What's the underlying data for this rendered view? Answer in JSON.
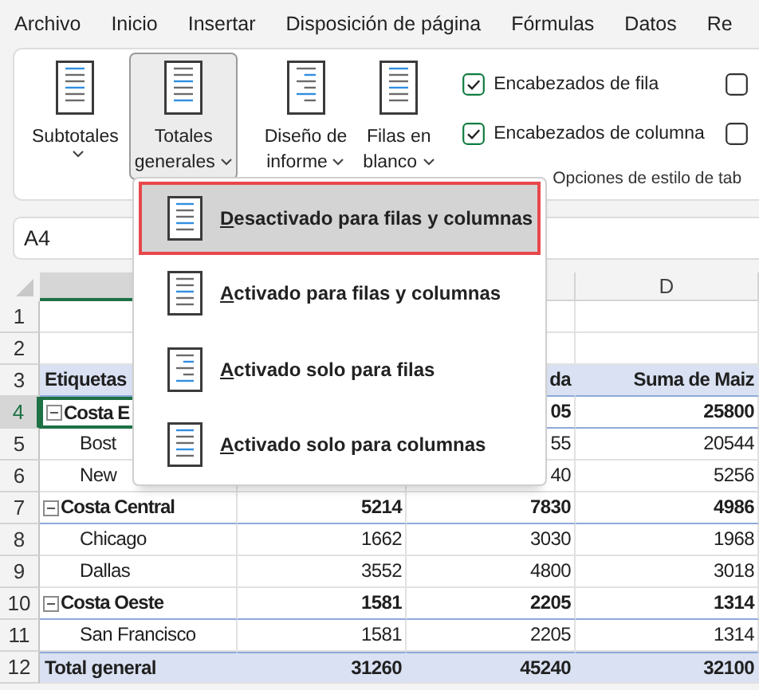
{
  "menu": [
    "Archivo",
    "Inicio",
    "Insertar",
    "Disposición de página",
    "Fórmulas",
    "Datos",
    "Re"
  ],
  "ribbon": {
    "buttons": [
      {
        "lines": [
          "Subtotales"
        ],
        "pressed": false
      },
      {
        "lines": [
          "Totales",
          "generales"
        ],
        "pressed": true
      },
      {
        "lines": [
          "Diseño de",
          "informe"
        ],
        "pressed": false
      },
      {
        "lines": [
          "Filas en",
          "blanco"
        ],
        "pressed": false
      }
    ],
    "checkboxes": [
      {
        "label": "Encabezados de fila",
        "checked": true
      },
      {
        "checked": false
      },
      {
        "label": "Encabezados de columna",
        "checked": true
      },
      {
        "checked": false
      }
    ],
    "group_label": "Opciones de estilo de tab"
  },
  "name_box": "A4",
  "column_header": "D",
  "rows": [
    {
      "number": "1",
      "kind": "blank",
      "selected": false
    },
    {
      "number": "2",
      "kind": "blank",
      "selected": false
    },
    {
      "number": "3",
      "kind": "header",
      "selected": false,
      "label": "Etiquetas",
      "column_c": "da",
      "column_d": "Suma de Maiz"
    },
    {
      "number": "4",
      "kind": "group",
      "selected": true,
      "label": "Costa E",
      "column_c": "05",
      "column_d": "25800"
    },
    {
      "number": "5",
      "kind": "item",
      "selected": false,
      "label": "Bost",
      "column_c": "55",
      "column_d": "20544"
    },
    {
      "number": "6",
      "kind": "item",
      "selected": false,
      "label": "New",
      "column_c": "40",
      "column_d": "5256"
    },
    {
      "number": "7",
      "kind": "group",
      "selected": false,
      "label": "Costa Central",
      "column_b": "5214",
      "column_c": "7830",
      "column_d": "4986"
    },
    {
      "number": "8",
      "kind": "item",
      "selected": false,
      "label": "Chicago",
      "column_b": "1662",
      "column_c": "3030",
      "column_d": "1968"
    },
    {
      "number": "9",
      "kind": "item",
      "selected": false,
      "label": "Dallas",
      "column_b": "3552",
      "column_c": "4800",
      "column_d": "3018"
    },
    {
      "number": "10",
      "kind": "group",
      "selected": false,
      "label": "Costa Oeste",
      "column_b": "1581",
      "column_c": "2205",
      "column_d": "1314"
    },
    {
      "number": "11",
      "kind": "item",
      "selected": false,
      "label": "San Francisco",
      "column_b": "1581",
      "column_c": "2205",
      "column_d": "1314"
    },
    {
      "number": "12",
      "kind": "total",
      "selected": false,
      "label": "Total general",
      "column_b": "31260",
      "column_c": "45240",
      "column_d": "32100"
    }
  ],
  "totals_menu": {
    "items": [
      {
        "label": "Desactivado para filas y columnas",
        "selected": true
      },
      {
        "label": "Activado para filas y columnas",
        "selected": false
      },
      {
        "label": "Activado solo para filas",
        "selected": false
      },
      {
        "label": "Activado solo para columnas",
        "selected": false
      }
    ]
  }
}
